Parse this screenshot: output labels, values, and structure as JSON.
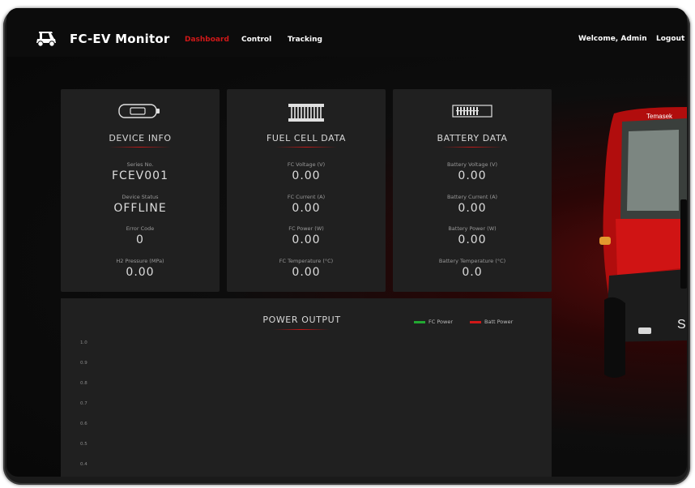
{
  "app": {
    "title": "FC-EV Monitor",
    "nav": [
      "Dashboard",
      "Control",
      "Tracking"
    ],
    "active_nav": "Dashboard",
    "welcome": "Welcome, Admin",
    "logout": "Logout",
    "accent": "#d01818"
  },
  "device": {
    "title": "DEVICE INFO",
    "icon": "battery-icon",
    "fields": [
      {
        "label": "Series No.",
        "value": "FCEV001"
      },
      {
        "label": "Device Status",
        "value": "OFFLINE"
      },
      {
        "label": "Error Code",
        "value": "0"
      },
      {
        "label": "H2 Pressure (MPa)",
        "value": "0.00"
      }
    ]
  },
  "fuel_cell": {
    "title": "FUEL CELL DATA",
    "icon": "fuel-cell-icon",
    "fields": [
      {
        "label": "FC Voltage (V)",
        "value": "0.00"
      },
      {
        "label": "FC Current (A)",
        "value": "0.00"
      },
      {
        "label": "FC Power (W)",
        "value": "0.00"
      },
      {
        "label": "FC Temperature (°C)",
        "value": "0.00"
      }
    ]
  },
  "battery": {
    "title": "BATTERY DATA",
    "icon": "battery-pack-icon",
    "fields": [
      {
        "label": "Battery Voltage (V)",
        "value": "0.00"
      },
      {
        "label": "Battery Current (A)",
        "value": "0.00"
      },
      {
        "label": "Battery Power (W)",
        "value": "0.00"
      },
      {
        "label": "Battery Temperature (°C)",
        "value": "0.0"
      }
    ]
  },
  "chart": {
    "title": "POWER OUTPUT",
    "legend": [
      {
        "name": "FC Power",
        "color": "#22a832"
      },
      {
        "name": "Batt Power",
        "color": "#d01818"
      }
    ],
    "y_ticks": [
      "1.0",
      "0.9",
      "0.8",
      "0.7",
      "0.6",
      "0.5",
      "0.4"
    ]
  },
  "vehicle_badge": "Temasek"
}
